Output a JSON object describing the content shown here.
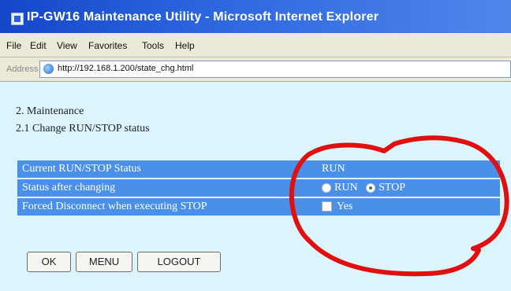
{
  "window": {
    "title": "IP-GW16 Maintenance Utility - Microsoft Internet Explorer"
  },
  "menubar": {
    "items": [
      "File",
      "Edit",
      "View",
      "Favorites",
      "Tools",
      "Help"
    ]
  },
  "addressbar": {
    "label": "Address",
    "url": "http://192.168.1.200/state_chg.html"
  },
  "page": {
    "heading": "2. Maintenance",
    "subheading": "2.1 Change RUN/STOP status",
    "rows": [
      {
        "label": "Current RUN/STOP Status",
        "value": "RUN"
      },
      {
        "label": "Status after changing",
        "options": [
          "RUN",
          "STOP"
        ],
        "selected": "STOP"
      },
      {
        "label": "Forced Disconnect when executing STOP",
        "checkbox_label": "Yes",
        "checked": false
      }
    ],
    "buttons": {
      "ok": "OK",
      "menu": "MENU",
      "logout": "LOGOUT"
    }
  },
  "colors": {
    "title_bar": "#2b66de",
    "content_bg": "#dcf4fc",
    "table_row": "#4a90e8",
    "annotation": "#e01010"
  }
}
